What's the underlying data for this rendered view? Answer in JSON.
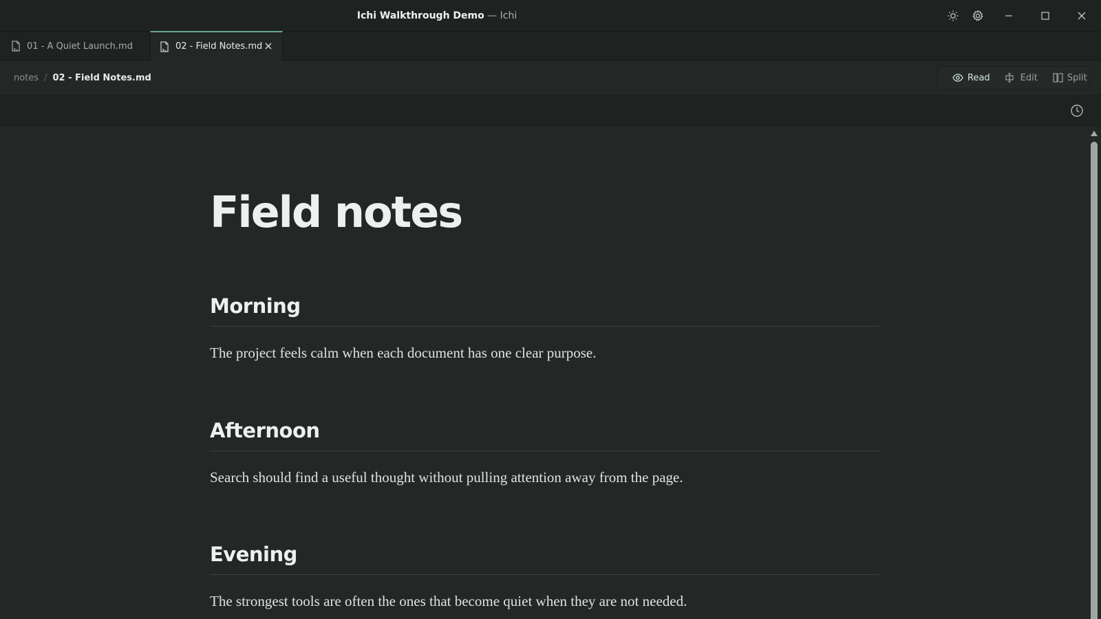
{
  "window": {
    "document_title": "Ichi Walkthrough Demo",
    "separator": " — ",
    "app_name": "Ichi"
  },
  "titlebar_icons": [
    "sun-icon",
    "gear-icon",
    "minimize-icon",
    "maximize-icon",
    "close-icon"
  ],
  "tabs": [
    {
      "label": "01 - A Quiet Launch.md",
      "active": false
    },
    {
      "label": "02 - Field Notes.md",
      "active": true
    }
  ],
  "breadcrumb": {
    "folder": "notes",
    "separator": "/",
    "file": "02 - Field Notes.md"
  },
  "modes": [
    {
      "label": "Read",
      "active": true
    },
    {
      "label": "Edit",
      "active": false
    },
    {
      "label": "Split",
      "active": false
    }
  ],
  "document": {
    "title": "Field notes",
    "sections": [
      {
        "heading": "Morning",
        "body": "The project feels calm when each document has one clear purpose."
      },
      {
        "heading": "Afternoon",
        "body": "Search should find a useful thought without pulling attention away from the page."
      },
      {
        "heading": "Evening",
        "body": "The strongest tools are often the ones that become quiet when they are not needed."
      }
    ]
  },
  "colors": {
    "background": "#232826",
    "chrome": "#1e2321",
    "accent": "#6aa58e",
    "text": "#dfe2e0"
  }
}
